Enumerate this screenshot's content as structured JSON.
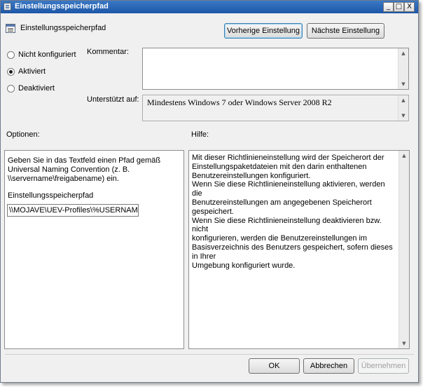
{
  "window": {
    "title": "Einstellungsspeicherpfad",
    "controls": {
      "minimize": "_",
      "maximize": "□",
      "close": "X"
    }
  },
  "header": {
    "title": "Einstellungsspeicherpfad",
    "prev_button": "Vorherige Einstellung",
    "next_button": "Nächste Einstellung"
  },
  "state": {
    "options": [
      {
        "label": "Nicht konfiguriert",
        "checked": false
      },
      {
        "label": "Aktiviert",
        "checked": true
      },
      {
        "label": "Deaktiviert",
        "checked": false
      }
    ]
  },
  "comment": {
    "label": "Kommentar:",
    "value": ""
  },
  "supported": {
    "label": "Unterstützt auf:",
    "value": "Mindestens Windows 7 oder Windows Server 2008 R2"
  },
  "options_section": {
    "label": "Optionen:",
    "description": "Geben Sie in das Textfeld einen Pfad gemäß Universal Naming Convention (z. B. \\\\servername\\freigabename) ein.",
    "field_label": "Einstellungsspeicherpfad",
    "field_value": "\\\\MOJAVE\\UEV-Profiles\\%USERNAME%"
  },
  "help_section": {
    "label": "Hilfe:",
    "lines": [
      "Mit dieser Richtlinieneinstellung wird der Speicherort der",
      "Einstellungspaketdateien mit den darin enthaltenen",
      "Benutzereinstellungen konfiguriert.",
      "Wenn Sie diese Richtlinieneinstellung aktivieren, werden die",
      "Benutzereinstellungen am angegebenen Speicherort gespeichert.",
      "Wenn Sie diese Richtlinieneinstellung deaktivieren bzw. nicht",
      "konfigurieren, werden die Benutzereinstellungen im",
      "Basisverzeichnis des Benutzers gespeichert, sofern dieses in Ihrer",
      "Umgebung konfiguriert wurde."
    ]
  },
  "footer": {
    "ok": "OK",
    "cancel": "Abbrechen",
    "apply": "Übernehmen"
  },
  "icons": {
    "app": "policy-setting-icon",
    "scroll_up": "▲",
    "scroll_down": "▼"
  }
}
